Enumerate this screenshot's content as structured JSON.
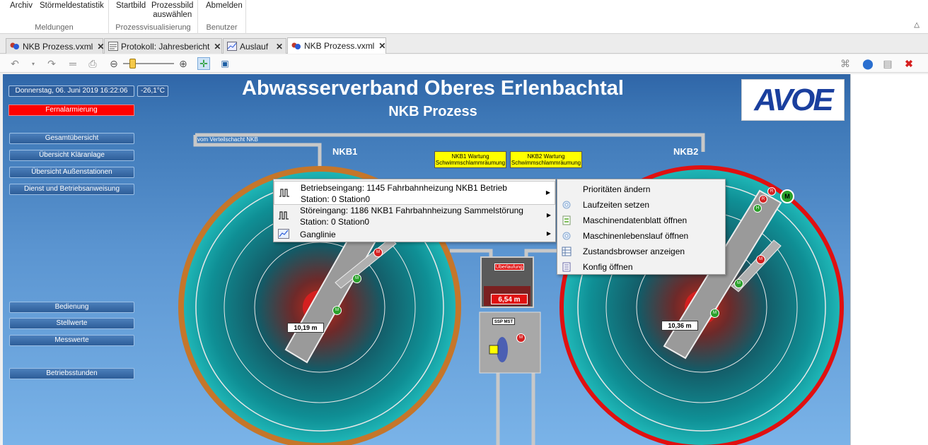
{
  "ribbon": {
    "groups": [
      {
        "label": "Meldungen",
        "buttons": [
          "Archiv",
          "Störmeldestatistik"
        ]
      },
      {
        "label": "Prozessvisualisierung",
        "buttons": [
          "Startbild",
          "Prozessbild\nauswählen"
        ]
      },
      {
        "label": "Benutzer",
        "buttons": [
          "Abmelden"
        ]
      }
    ]
  },
  "tabs": [
    {
      "label": "NKB Prozess.vxml",
      "active": false
    },
    {
      "label": "Protokoll: Jahresbericht",
      "active": false
    },
    {
      "label": "Auslauf",
      "active": false
    },
    {
      "label": "NKB Prozess.vxml",
      "active": true
    }
  ],
  "toolbar": {
    "zoom_level": 0.15
  },
  "scada": {
    "datetime": "Donnerstag, 06. Juni 2019 16:22:06",
    "temperature": "-26,1°C",
    "alarm_label": "Fernalarmierung",
    "title": "Abwasserverband Oberes Erlenbachtal",
    "subtitle": "NKB Prozess",
    "logo_text": "AVOE",
    "nav_top": [
      "Gesamtübersicht",
      "Übersicht Kläranlage",
      "Übersicht Außenstationen",
      "Dienst und Betriebsanweisung"
    ],
    "nav_bottom": [
      "Bedienung",
      "Stellwerte",
      "Messwerte"
    ],
    "nav_hours": "Betriebsstunden",
    "pipe_label": "vom Verteilschacht NKB",
    "tank1": {
      "label": "NKB1",
      "level": "10,19 m",
      "ring_color": "#c5762a"
    },
    "tank2": {
      "label": "NKB2",
      "level": "10,36 m",
      "ring_color": "#e01010"
    },
    "maint1": "NKB1 Wartung\nSchwimmschlammräumung",
    "maint2": "NKB2 Wartung\nSchwimmschlammräumung",
    "overflow_label": "Überlaufung",
    "overflow_value": "6,54 m",
    "pump_station_label": "SSP MST",
    "motor_labels": {
      "m": "M",
      "h": "H",
      "r": "R"
    }
  },
  "context_menu": {
    "items": [
      {
        "line1": "Betriebseingang: 1145 Fahrbahnheizung NKB1 Betrieb",
        "line2": "Station: 0 Station0",
        "icon": "signal-icon"
      },
      {
        "line1": "Störeingang: 1186 NKB1 Fahrbahnheizung Sammelstörung",
        "line2": "Station: 0 Station0",
        "icon": "signal-icon"
      },
      {
        "line1": "Ganglinie",
        "line2": "",
        "icon": "chart-icon"
      }
    ],
    "submenu": [
      {
        "label": "Prioritäten ändern",
        "icon": ""
      },
      {
        "label": "Laufzeiten setzen",
        "icon": "gear-icon"
      },
      {
        "label": "Maschinendatenblatt öffnen",
        "icon": "sheet-icon"
      },
      {
        "label": "Maschinenlebenslauf öffnen",
        "icon": "gear-icon"
      },
      {
        "label": "Zustandsbrowser anzeigen",
        "icon": "table-icon"
      },
      {
        "label": "Konfig öffnen",
        "icon": "list-icon"
      }
    ]
  }
}
